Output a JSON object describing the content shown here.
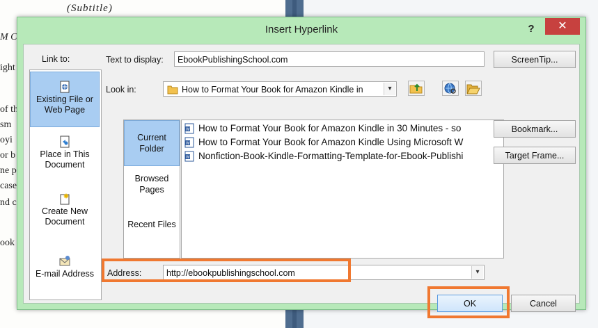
{
  "background": {
    "subtitle": "(Subtitle)",
    "margin_fragments": [
      "M C",
      "ight",
      "",
      "of th",
      "sm",
      "oyi",
      "or b",
      "ne p",
      "case",
      "nd c",
      "",
      "ook"
    ]
  },
  "dialog": {
    "title": "Insert Hyperlink",
    "help_label": "?",
    "close_label": "✕",
    "accent": "#b7e9b9",
    "close_color": "#c7413f",
    "highlight_color": "#f07830"
  },
  "link_to": {
    "label": "Link to:",
    "items": [
      {
        "label": "Existing File or Web Page",
        "icon": "existing-file-icon",
        "selected": true
      },
      {
        "label": "Place in This Document",
        "icon": "place-in-document-icon",
        "selected": false
      },
      {
        "label": "Create New Document",
        "icon": "new-document-icon",
        "selected": false
      },
      {
        "label": "E-mail Address",
        "icon": "email-icon",
        "selected": false
      }
    ]
  },
  "text_to_display": {
    "label": "Text to display:",
    "value": "EbookPublishingSchool.com"
  },
  "screentip_label": "ScreenTip...",
  "look_in": {
    "label": "Look in:",
    "value": "How to Format Your Book for Amazon Kindle in",
    "arrow": "▾"
  },
  "tabs": [
    {
      "label": "Current Folder",
      "selected": true
    },
    {
      "label": "Browsed Pages",
      "selected": false
    },
    {
      "label": "Recent Files",
      "selected": false
    }
  ],
  "files": [
    "How to Format Your Book for Amazon Kindle in 30 Minutes - so",
    "How to Format Your Book for Amazon Kindle Using Microsoft W",
    "Nonfiction-Book-Kindle-Formatting-Template-for-Ebook-Publishi"
  ],
  "bookmark_label": "Bookmark...",
  "target_frame_label": "Target Frame...",
  "address": {
    "label": "Address:",
    "value": "http://ebookpublishingschool.com",
    "arrow": "▾"
  },
  "ok_label": "OK",
  "cancel_label": "Cancel"
}
